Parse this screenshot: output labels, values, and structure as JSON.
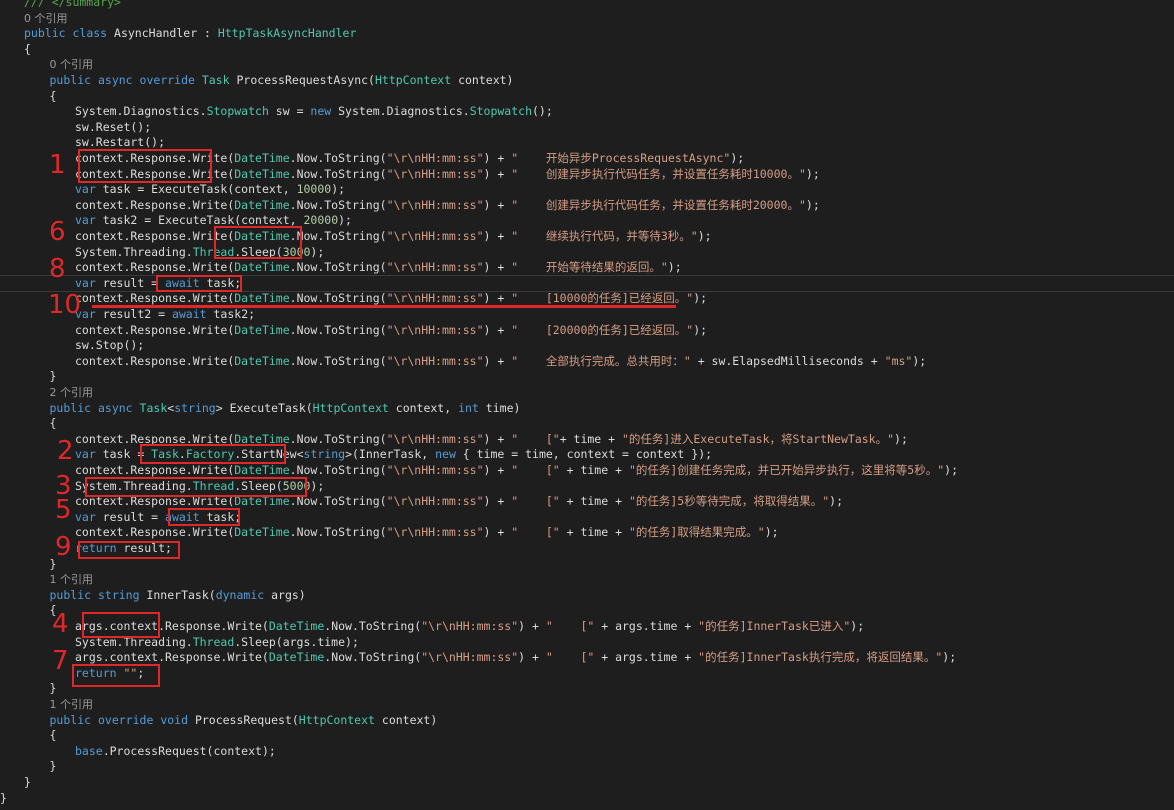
{
  "editor": {
    "lines": [
      {
        "cls": "cm",
        "indent": 0,
        "text": "/// </summary>"
      },
      {
        "cls": "ref",
        "indent": 0,
        "text": "0 个引用"
      },
      {
        "cls": "code",
        "indent": 0,
        "text": "public class AsyncHandler : HttpTaskAsyncHandler"
      },
      {
        "cls": "code",
        "indent": 0,
        "text": "{"
      },
      {
        "cls": "ref",
        "indent": 1,
        "text": "0 个引用"
      },
      {
        "cls": "code",
        "indent": 1,
        "text": "public async override Task ProcessRequestAsync(HttpContext context)"
      },
      {
        "cls": "code",
        "indent": 1,
        "text": "{"
      },
      {
        "cls": "code",
        "indent": 2,
        "text": "System.Diagnostics.Stopwatch sw = new System.Diagnostics.Stopwatch();"
      },
      {
        "cls": "code",
        "indent": 2,
        "text": "sw.Reset();"
      },
      {
        "cls": "code",
        "indent": 2,
        "text": "sw.Restart();"
      },
      {
        "cls": "code",
        "indent": 2,
        "text": "context.Response.Write(DateTime.Now.ToString(\"\\r\\nHH:mm:ss\") + \"    开始异步ProcessRequestAsync\");"
      },
      {
        "cls": "code",
        "indent": 2,
        "text": "context.Response.Write(DateTime.Now.ToString(\"\\r\\nHH:mm:ss\") + \"    创建异步执行代码任务，并设置任务耗时10000。\");"
      },
      {
        "cls": "code",
        "indent": 2,
        "text": "var task = ExecuteTask(context, 10000);"
      },
      {
        "cls": "code",
        "indent": 2,
        "text": "context.Response.Write(DateTime.Now.ToString(\"\\r\\nHH:mm:ss\") + \"    创建异步执行代码任务，并设置任务耗时20000。\");"
      },
      {
        "cls": "code",
        "indent": 2,
        "text": "var task2 = ExecuteTask(context, 20000);"
      },
      {
        "cls": "code",
        "indent": 2,
        "text": "context.Response.Write(DateTime.Now.ToString(\"\\r\\nHH:mm:ss\") + \"    继续执行代码，并等待3秒。\");"
      },
      {
        "cls": "code",
        "indent": 2,
        "text": "System.Threading.Thread.Sleep(3000);"
      },
      {
        "cls": "code",
        "indent": 2,
        "text": "context.Response.Write(DateTime.Now.ToString(\"\\r\\nHH:mm:ss\") + \"    开始等待结果的返回。\");"
      },
      {
        "cls": "code",
        "indent": 2,
        "text": "var result = await task;"
      },
      {
        "cls": "code",
        "indent": 2,
        "text": "context.Response.Write(DateTime.Now.ToString(\"\\r\\nHH:mm:ss\") + \"    [10000的任务]已经返回。\");"
      },
      {
        "cls": "code",
        "indent": 2,
        "text": "var result2 = await task2;"
      },
      {
        "cls": "code",
        "indent": 2,
        "text": "context.Response.Write(DateTime.Now.ToString(\"\\r\\nHH:mm:ss\") + \"    [20000的任务]已经返回。\");"
      },
      {
        "cls": "code",
        "indent": 2,
        "text": "sw.Stop();"
      },
      {
        "cls": "code",
        "indent": 2,
        "text": "context.Response.Write(DateTime.Now.ToString(\"\\r\\nHH:mm:ss\") + \"    全部执行完成。总共用时：\" + sw.ElapsedMilliseconds + \"ms\");"
      },
      {
        "cls": "code",
        "indent": 1,
        "text": "}"
      },
      {
        "cls": "ref",
        "indent": 1,
        "text": "2 个引用"
      },
      {
        "cls": "code",
        "indent": 1,
        "text": "public async Task<string> ExecuteTask(HttpContext context, int time)"
      },
      {
        "cls": "code",
        "indent": 1,
        "text": "{"
      },
      {
        "cls": "code",
        "indent": 2,
        "text": "context.Response.Write(DateTime.Now.ToString(\"\\r\\nHH:mm:ss\") + \"    [\"+ time + \"的任务]进入ExecuteTask，将StartNewTask。\");"
      },
      {
        "cls": "code",
        "indent": 2,
        "text": "var task = Task.Factory.StartNew<string>(InnerTask, new { time = time, context = context });"
      },
      {
        "cls": "code",
        "indent": 2,
        "text": "context.Response.Write(DateTime.Now.ToString(\"\\r\\nHH:mm:ss\") + \"    [\" + time + \"的任务]创建任务完成，并已开始异步执行，这里将等5秒。\");"
      },
      {
        "cls": "code",
        "indent": 2,
        "text": "System.Threading.Thread.Sleep(5000);"
      },
      {
        "cls": "code",
        "indent": 2,
        "text": "context.Response.Write(DateTime.Now.ToString(\"\\r\\nHH:mm:ss\") + \"    [\" + time + \"的任务]5秒等待完成，将取得结果。\");"
      },
      {
        "cls": "code",
        "indent": 2,
        "text": "var result = await task;"
      },
      {
        "cls": "code",
        "indent": 2,
        "text": "context.Response.Write(DateTime.Now.ToString(\"\\r\\nHH:mm:ss\") + \"    [\" + time + \"的任务]取得结果完成。\");"
      },
      {
        "cls": "code",
        "indent": 2,
        "text": "return result;"
      },
      {
        "cls": "code",
        "indent": 1,
        "text": "}"
      },
      {
        "cls": "ref",
        "indent": 1,
        "text": "1 个引用"
      },
      {
        "cls": "code",
        "indent": 1,
        "text": "public string InnerTask(dynamic args)"
      },
      {
        "cls": "code",
        "indent": 1,
        "text": "{"
      },
      {
        "cls": "code",
        "indent": 2,
        "text": "args.context.Response.Write(DateTime.Now.ToString(\"\\r\\nHH:mm:ss\") + \"    [\" + args.time + \"的任务]InnerTask已进入\");"
      },
      {
        "cls": "code",
        "indent": 2,
        "text": "System.Threading.Thread.Sleep(args.time);"
      },
      {
        "cls": "code",
        "indent": 2,
        "text": "args.context.Response.Write(DateTime.Now.ToString(\"\\r\\nHH:mm:ss\") + \"    [\" + args.time + \"的任务]InnerTask执行完成，将返回结果。\");"
      },
      {
        "cls": "code",
        "indent": 2,
        "text": "return \"\";"
      },
      {
        "cls": "code",
        "indent": 1,
        "text": "}"
      },
      {
        "cls": "ref",
        "indent": 1,
        "text": "1 个引用"
      },
      {
        "cls": "code",
        "indent": 1,
        "text": "public override void ProcessRequest(HttpContext context)"
      },
      {
        "cls": "code",
        "indent": 1,
        "text": "{"
      },
      {
        "cls": "code",
        "indent": 2,
        "text": "base.ProcessRequest(context);"
      },
      {
        "cls": "code",
        "indent": 1,
        "text": "}"
      },
      {
        "cls": "code",
        "indent": 0,
        "text": "}"
      },
      {
        "cls": "code",
        "indent": -1,
        "text": "}"
      }
    ]
  },
  "annotations": {
    "numbers": [
      "1",
      "6",
      "8",
      "10",
      "2",
      "3",
      "5",
      "9",
      "4",
      "7"
    ],
    "color": "#e0282a"
  },
  "theme": {
    "background": "#1e1e1e",
    "keyword": "#569cd6",
    "type": "#4ec9b0",
    "string": "#d69d85",
    "number": "#b5cea8",
    "comment": "#57a64a"
  }
}
